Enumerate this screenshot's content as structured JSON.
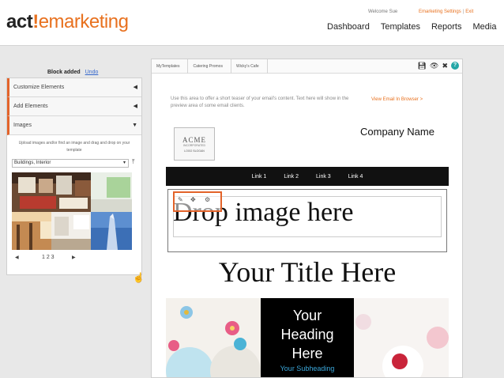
{
  "header": {
    "logo_act": "act",
    "logo_bang": "!",
    "logo_rest": "emarketing",
    "welcome": "Welcome Sue",
    "settings_link": "Emarketing Settings",
    "exit_link": "Exit",
    "nav": [
      "Dashboard",
      "Templates",
      "Reports",
      "Media"
    ]
  },
  "left": {
    "status": "Block added",
    "undo": "Undo",
    "accordion": [
      {
        "label": "Customize Elements",
        "arrow": "◀"
      },
      {
        "label": "Add Elements",
        "arrow": "◀"
      },
      {
        "label": "Images",
        "arrow": "▼"
      }
    ],
    "images_help": "Upload images and/or find an image and drag and drop on your template",
    "category": "Buildings, Interior",
    "pager": {
      "prev": "◀",
      "pages": "1  2  3",
      "next": "▶"
    }
  },
  "editor": {
    "crumbs": [
      "MyTemplates",
      "Catering Promos",
      "Wicky's Cafe"
    ],
    "teaser": "Use this area to offer a short teaser of your email's content. Text here will show in the preview area of some email clients.",
    "browser_link": "View Email In Browser >",
    "logo_name": "ACME",
    "logo_sub": "INCORPORATED",
    "logo_slogan": "LOGO SLOGAN",
    "company_name": "Company Name",
    "links": [
      "Link 1",
      "Link 2",
      "Link 3",
      "Link 4"
    ],
    "drop_text": "Drop image here",
    "title": "Your Title Here",
    "heading": [
      "Your",
      "Heading",
      "Here"
    ],
    "subheading": "Your Subheading"
  },
  "colors": {
    "brand_orange": "#e8711f",
    "accent_orange": "#e3632a",
    "help_teal": "#23a6a6",
    "subheading_blue": "#3aa6d9"
  }
}
